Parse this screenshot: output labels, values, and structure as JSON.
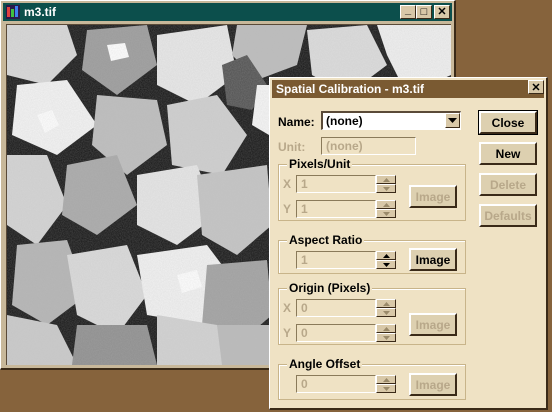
{
  "image_window": {
    "title": "m3.tif",
    "controls": {
      "minimize": "_",
      "maximize": "□",
      "close": "✕"
    }
  },
  "dialog": {
    "title": "Spatial Calibration - m3.tif",
    "close": "✕",
    "name_label": "Name:",
    "name_value": "(none)",
    "unit_label": "Unit:",
    "unit_value": "(none)",
    "pixels_per_unit": {
      "title": "Pixels/Unit",
      "x_label": "X",
      "x_value": "1",
      "y_label": "Y",
      "y_value": "1",
      "image_button": "Image"
    },
    "aspect_ratio": {
      "title": "Aspect Ratio",
      "value": "1",
      "image_button": "Image"
    },
    "origin": {
      "title": "Origin (Pixels)",
      "x_label": "X",
      "x_value": "0",
      "y_label": "Y",
      "y_value": "0",
      "image_button": "Image"
    },
    "angle_offset": {
      "title": "Angle Offset",
      "value": "0",
      "image_button": "Image"
    },
    "buttons": {
      "close": "Close",
      "new": "New",
      "delete": "Delete",
      "defaults": "Defaults"
    }
  },
  "colors": {
    "desktop": "#86633c",
    "window_title_active": "#0c4f4c",
    "dialog_title": "#7a5a32",
    "dialog_face": "#efe2c4",
    "disabled_text": "#b8a88a"
  }
}
